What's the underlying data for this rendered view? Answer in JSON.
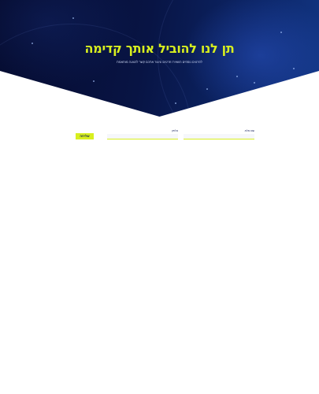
{
  "hero": {
    "title": "תן לנו להוביל אותך קדימה",
    "subtitle": "לפרטים נוספים השאירו פרטים וניצור אתכם קשר להצעה מותאמת",
    "colors": {
      "background_dark": "#050b2e",
      "background_light": "#123684",
      "title": "#d8ef1f",
      "subtitle": "#c9d3f0"
    }
  },
  "form": {
    "fields": [
      {
        "label": "שם מלא",
        "value": "",
        "placeholder": ""
      },
      {
        "label": "טלפון",
        "value": "",
        "placeholder": ""
      }
    ],
    "submit_label": "שליחה",
    "colors": {
      "accent": "#d8ef1f",
      "label": "#1a2460",
      "input_bg": "#f6f7fb"
    }
  }
}
